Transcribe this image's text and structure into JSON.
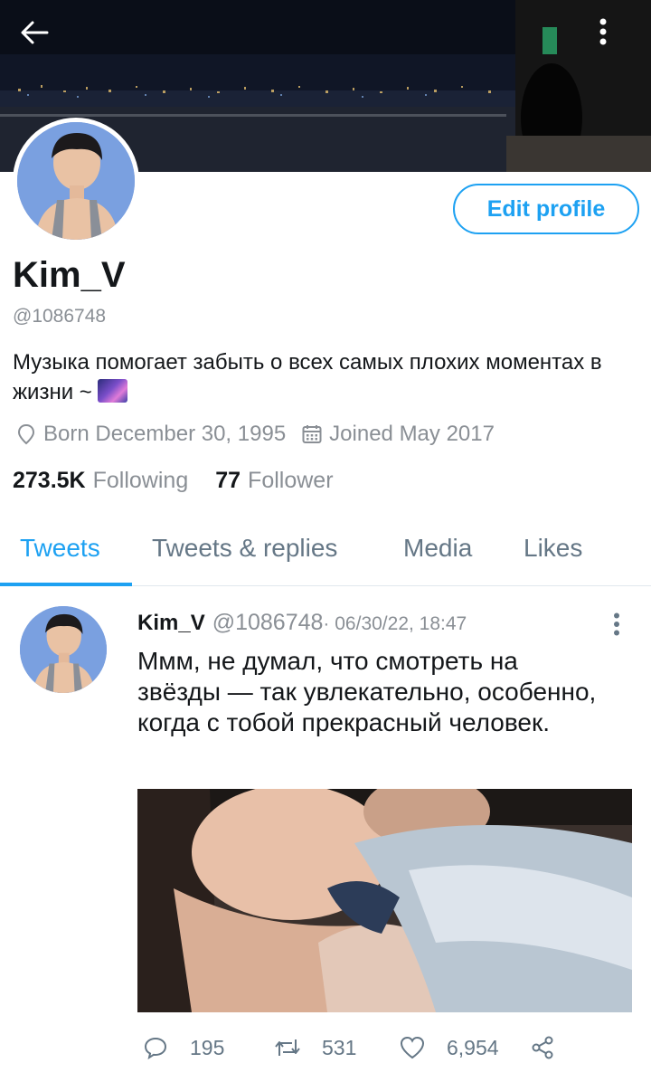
{
  "profile": {
    "name": "Kim_V",
    "handle": "@1086748",
    "bio": "Музыка помогает забыть о всех самых плохих моментах в жизни ~",
    "born": "Born December 30, 1995",
    "joined": "Joined May 2017",
    "following_count": "273.5K",
    "following_label": "Following",
    "followers_count": "77",
    "followers_label": "Follower",
    "edit_button": "Edit profile"
  },
  "tabs": [
    {
      "label": "Tweets",
      "active": true
    },
    {
      "label": "Tweets & replies",
      "active": false
    },
    {
      "label": "Media",
      "active": false
    },
    {
      "label": "Likes",
      "active": false
    }
  ],
  "tweet": {
    "name": "Kim_V",
    "handle": "@1086748",
    "date": "· 06/30/22, 18:47",
    "text": "Ммм, не думал, что смотреть на звёзды — так увлекательно, особенно, когда с тобой прекрасный человек.",
    "replies": "195",
    "retweets": "531",
    "likes": "6,954"
  },
  "icons": {
    "back": "arrow-left-icon",
    "menu": "more-vertical-icon",
    "location": "location-pin-icon",
    "calendar": "calendar-icon",
    "reply": "comment-icon",
    "retweet": "retweet-icon",
    "like": "heart-icon",
    "share": "share-icon"
  },
  "colors": {
    "accent": "#1da1f2",
    "muted": "#8a8f95",
    "text": "#14171a"
  }
}
